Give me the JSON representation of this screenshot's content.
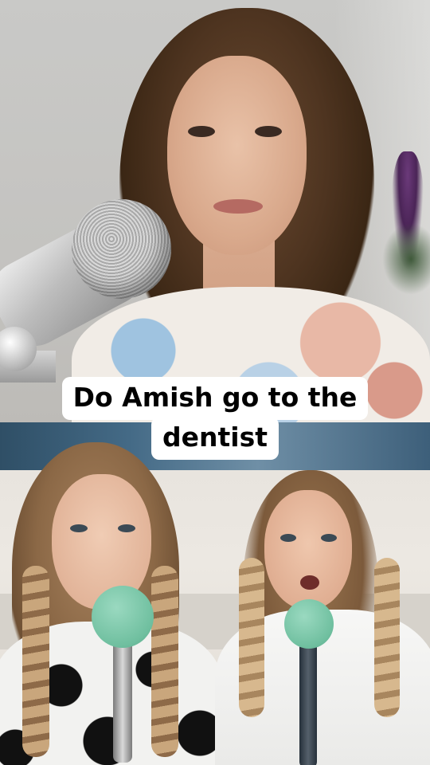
{
  "video": {
    "top_panel": {
      "label": ""
    },
    "bottom_panel": {
      "label": ""
    }
  },
  "caption": {
    "lines": [
      "Do Amish go to the",
      "dentist"
    ]
  },
  "colors": {
    "caption_background": "#ffffff",
    "caption_text": "#000000",
    "mic_foam": "#6fbf9f"
  },
  "icons": {
    "microphone_top": "microphone-icon",
    "microphone_left": "microphone-icon",
    "microphone_right": "microphone-icon"
  }
}
